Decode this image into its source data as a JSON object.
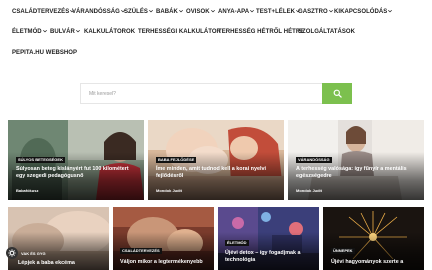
{
  "nav": {
    "row1": [
      {
        "label": "CSALÁDTERVEZÉS",
        "has_dropdown": true
      },
      {
        "label": "VÁRANDÓSSÁG",
        "has_dropdown": true
      },
      {
        "label": "SZÜLÉS",
        "has_dropdown": true
      },
      {
        "label": "BABÁK",
        "has_dropdown": true
      },
      {
        "label": "OVISOK",
        "has_dropdown": true
      },
      {
        "label": "ANYA-APA",
        "has_dropdown": true
      },
      {
        "label": "TEST+LÉLEK",
        "has_dropdown": true
      },
      {
        "label": "GASZTRO",
        "has_dropdown": true
      },
      {
        "label": "KIKAPCSOLÓDÁS",
        "has_dropdown": true
      }
    ],
    "row2": [
      {
        "label": "ÉLETMÓD",
        "has_dropdown": true
      },
      {
        "label": "BULVÁR",
        "has_dropdown": true
      },
      {
        "label": "KALKULÁTOROK",
        "has_dropdown": false
      },
      {
        "label": "TERHESSÉGI KALKULÁTOR",
        "has_dropdown": false
      },
      {
        "label": "TERHESSÉG HÉTRŐL HÉTRE",
        "has_dropdown": false
      },
      {
        "label": "SZOLGÁLTATÁSOK",
        "has_dropdown": false
      }
    ],
    "row3": [
      {
        "label": "PEPITA.HU WEBSHOP",
        "has_dropdown": false
      }
    ]
  },
  "search": {
    "placeholder": "Mit keresel?",
    "button_icon": "search-icon"
  },
  "cards_top": [
    {
      "badge": "SÚLYOS BETEGSÉGEK",
      "title": "Súlyosan beteg kislányért fut 100 kilométert egy szegedi pedagógusnő",
      "author": "Babafókusz"
    },
    {
      "badge": "BABA FEJLŐDÉSE",
      "title": "Íme minden, amit tudnod kell a korai nyelvi fejlődésről",
      "author": "Mondok Judit"
    },
    {
      "badge": "VÁRANDÓSSÁG",
      "title": "A terhesség valósága: így fűnyír a mentális egészségedre",
      "author": "Mondok Judit"
    }
  ],
  "cards_bottom": [
    {
      "badge": "",
      "title": "Lépjek a baba ekcéma"
    },
    {
      "badge": "CSALÁDTERVEZÉS",
      "title": "Váljon mikor a legtermékenyebb"
    },
    {
      "badge": "ÉLETMÓD",
      "title": "Újévi detox – így fogadjmak a technológia"
    },
    {
      "badge": "ÜNNEPEK",
      "title": "Újévi hagyományok szerte a"
    }
  ],
  "accessibility": {
    "label": "VAK ÉS GYG",
    "icon": "accessibility-gear-icon"
  },
  "colors": {
    "accent_green": "#7cc04e",
    "badge_bg": "#111111",
    "nav_text": "#222222"
  }
}
